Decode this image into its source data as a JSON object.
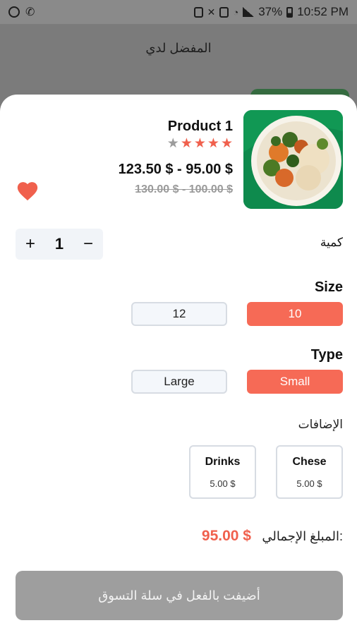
{
  "status_bar": {
    "battery": "37%",
    "time": "10:52 PM"
  },
  "app_bar": {
    "title": "المفضل لدي"
  },
  "product": {
    "name": "Product 1",
    "rating": 5,
    "price_current": "123.50 $ - 95.00 $",
    "price_old": "130.00 $ - 100.00 $",
    "favorite": true,
    "accent_color": "#f0604d"
  },
  "quantity": {
    "label": "كمية",
    "value": "1",
    "plus": "+",
    "minus": "−"
  },
  "size": {
    "title": "Size",
    "options": [
      "10",
      "12"
    ],
    "selected": "10"
  },
  "type": {
    "title": "Type",
    "options": [
      "Small",
      "Large"
    ],
    "selected": "Small"
  },
  "addons": {
    "label": "الإضافات",
    "items": [
      {
        "name": "Chese",
        "price": "5.00 $"
      },
      {
        "name": "Drinks",
        "price": "5.00 $"
      }
    ]
  },
  "total": {
    "label": "المبلغ الإجمالي:",
    "value": "95.00 $"
  },
  "cart_button": {
    "label": "أضيفت بالفعل في سلة التسوق"
  }
}
